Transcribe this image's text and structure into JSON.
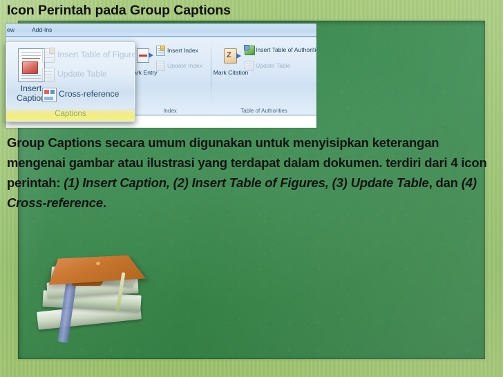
{
  "slide": {
    "title": "Icon Perintah pada Group Captions",
    "body_segments": [
      {
        "text": "Group Captions secara umum digunakan untuk menyisipkan keterangan mengenai gambar atau ilustrasi yang terdapat dalam dokumen. terdiri dari 4 icon perintah: ",
        "style": "normal"
      },
      {
        "text": "(1) Insert Caption, (2) Insert Table of Figures, (3) Update Table",
        "style": "italic"
      },
      {
        "text": ", dan ",
        "style": "normal"
      },
      {
        "text": "(4) Cross-reference",
        "style": "italic"
      },
      {
        "text": ".",
        "style": "normal"
      }
    ],
    "body_full": "Group Captions secara umum digunakan untuk menyisipkan keterangan mengenai gambar atau ilustrasi yang terdapat dalam dokumen. terdiri dari 4 icon perintah: (1) Insert Caption, (2) Insert Table of Figures, (3) Update Table, dan (4) Cross-reference."
  },
  "colors": {
    "frame_green": "#9CC470",
    "board_green": "#3A8A50",
    "title_text": "#111111",
    "body_text": "#131313",
    "highlight_yellow": "#F6EF72",
    "ribbon_blue": "#CFE1F3"
  },
  "ribbon": {
    "tabs": [
      {
        "label": "ew"
      },
      {
        "label": "Add-Ins"
      }
    ],
    "groups": [
      {
        "name": "Captions",
        "label": "Captions",
        "items": [
          {
            "label": "Insert Caption",
            "state": "enabled",
            "size": "large"
          },
          {
            "label": "Insert Table of Figures",
            "state": "disabled",
            "size": "small"
          },
          {
            "label": "Update Table",
            "state": "disabled",
            "size": "small"
          },
          {
            "label": "Cross-reference",
            "state": "enabled",
            "size": "small"
          }
        ]
      },
      {
        "name": "Index",
        "label": "Index",
        "items": [
          {
            "label": "Mark Entry",
            "state": "enabled",
            "size": "large"
          },
          {
            "label": "Insert Index",
            "state": "enabled",
            "size": "small"
          },
          {
            "label": "Update Index",
            "state": "disabled",
            "size": "small"
          }
        ]
      },
      {
        "name": "Table of Authorities",
        "label": "Table of Authorities",
        "items": [
          {
            "label": "Mark Citation",
            "state": "enabled",
            "size": "large"
          },
          {
            "label": "Insert Table of Authorities",
            "state": "enabled",
            "size": "small"
          },
          {
            "label": "Update Table",
            "state": "disabled",
            "size": "small"
          }
        ]
      }
    ]
  },
  "callout": {
    "group_label": "Captions",
    "big_button": {
      "line1": "Insert",
      "line2": "Caption"
    },
    "items": [
      {
        "label": "Insert Table of Figures",
        "state": "disabled"
      },
      {
        "label": "Update Table",
        "state": "disabled"
      },
      {
        "label": "Cross-reference",
        "state": "enabled"
      }
    ]
  },
  "illustration": {
    "name": "graduation-cap-on-books"
  }
}
